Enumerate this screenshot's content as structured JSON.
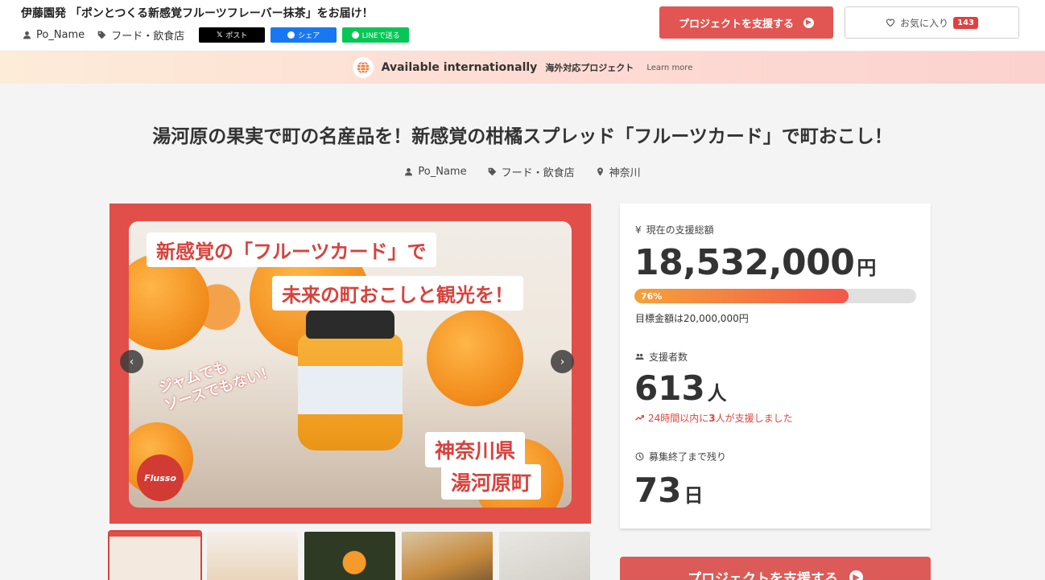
{
  "header": {
    "title": "伊藤園発 「ポンとつくる新感覚フルーツフレーバー抹茶」をお届け！",
    "owner": "Po_Name",
    "category": "フード・飲食店",
    "share_x": "ポスト",
    "share_fb": "シェア",
    "share_line": "LINEで送る",
    "support_button": "プロジェクトを支援する",
    "favorite_label": "お気に入り",
    "favorite_count": "143"
  },
  "banner": {
    "main": "Available internationally",
    "sub": "海外対応プロジェクト",
    "learn_more": "Learn more"
  },
  "project": {
    "title": "湯河原の果実で町の名産品を！新感覚の柑橘スプレッド「フルーツカード」で町おこし！",
    "owner": "Po_Name",
    "category": "フード・飲食店",
    "location": "神奈川"
  },
  "hero": {
    "line1": "新感覚の「フルーツカード」で",
    "line2": "未来の町おこしと観光を！",
    "diag1": "ジャムでも",
    "diag2": "ソースでもない！",
    "place1": "神奈川県",
    "place2": "湯河原町",
    "logo": "Flusso",
    "prev": "‹",
    "next": "›"
  },
  "stats": {
    "total_label": "現在の支援総額",
    "total_amount": "18,532,000",
    "yen_unit": "円",
    "progress_percent": 76,
    "progress_label": "76%",
    "goal_text": "目標金額は20,000,000円",
    "backers_label": "支援者数",
    "backers_count": "613",
    "backers_unit": "人",
    "recent_prefix": "24時間以内に",
    "recent_count": "3",
    "recent_suffix": "人が支援しました",
    "remaining_label": "募集終了まで残り",
    "remaining_days": "73",
    "days_unit": "日",
    "yen_symbol": "¥"
  },
  "support_main": "プロジェクトを支援する",
  "colors": {
    "accent": "#e15552",
    "progress_start": "#f6a13a",
    "progress_end": "#f1584a"
  }
}
